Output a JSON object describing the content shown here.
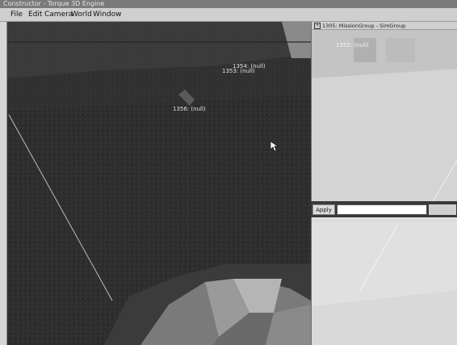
{
  "window": {
    "title": "Constructor - Torque 3D Engine"
  },
  "menu": {
    "items": [
      {
        "label": "File"
      },
      {
        "label": "Edit"
      },
      {
        "label": "Camera"
      },
      {
        "label": "World"
      },
      {
        "label": "Window"
      }
    ]
  },
  "viewport": {
    "labels": [
      {
        "text": "1354: (null)"
      },
      {
        "text": "1353: (null)"
      },
      {
        "text": "1356: (null)"
      }
    ]
  },
  "inspector": {
    "header": "1305: MissionGroup - SimGroup",
    "overlay_label": "1352: (null)"
  },
  "apply_bar": {
    "button_label": "Apply",
    "field_value": ""
  },
  "colors": {
    "menubar": "#cfcfcf",
    "terrain": "#2d2d2d",
    "panel": "#dcdcdc"
  }
}
